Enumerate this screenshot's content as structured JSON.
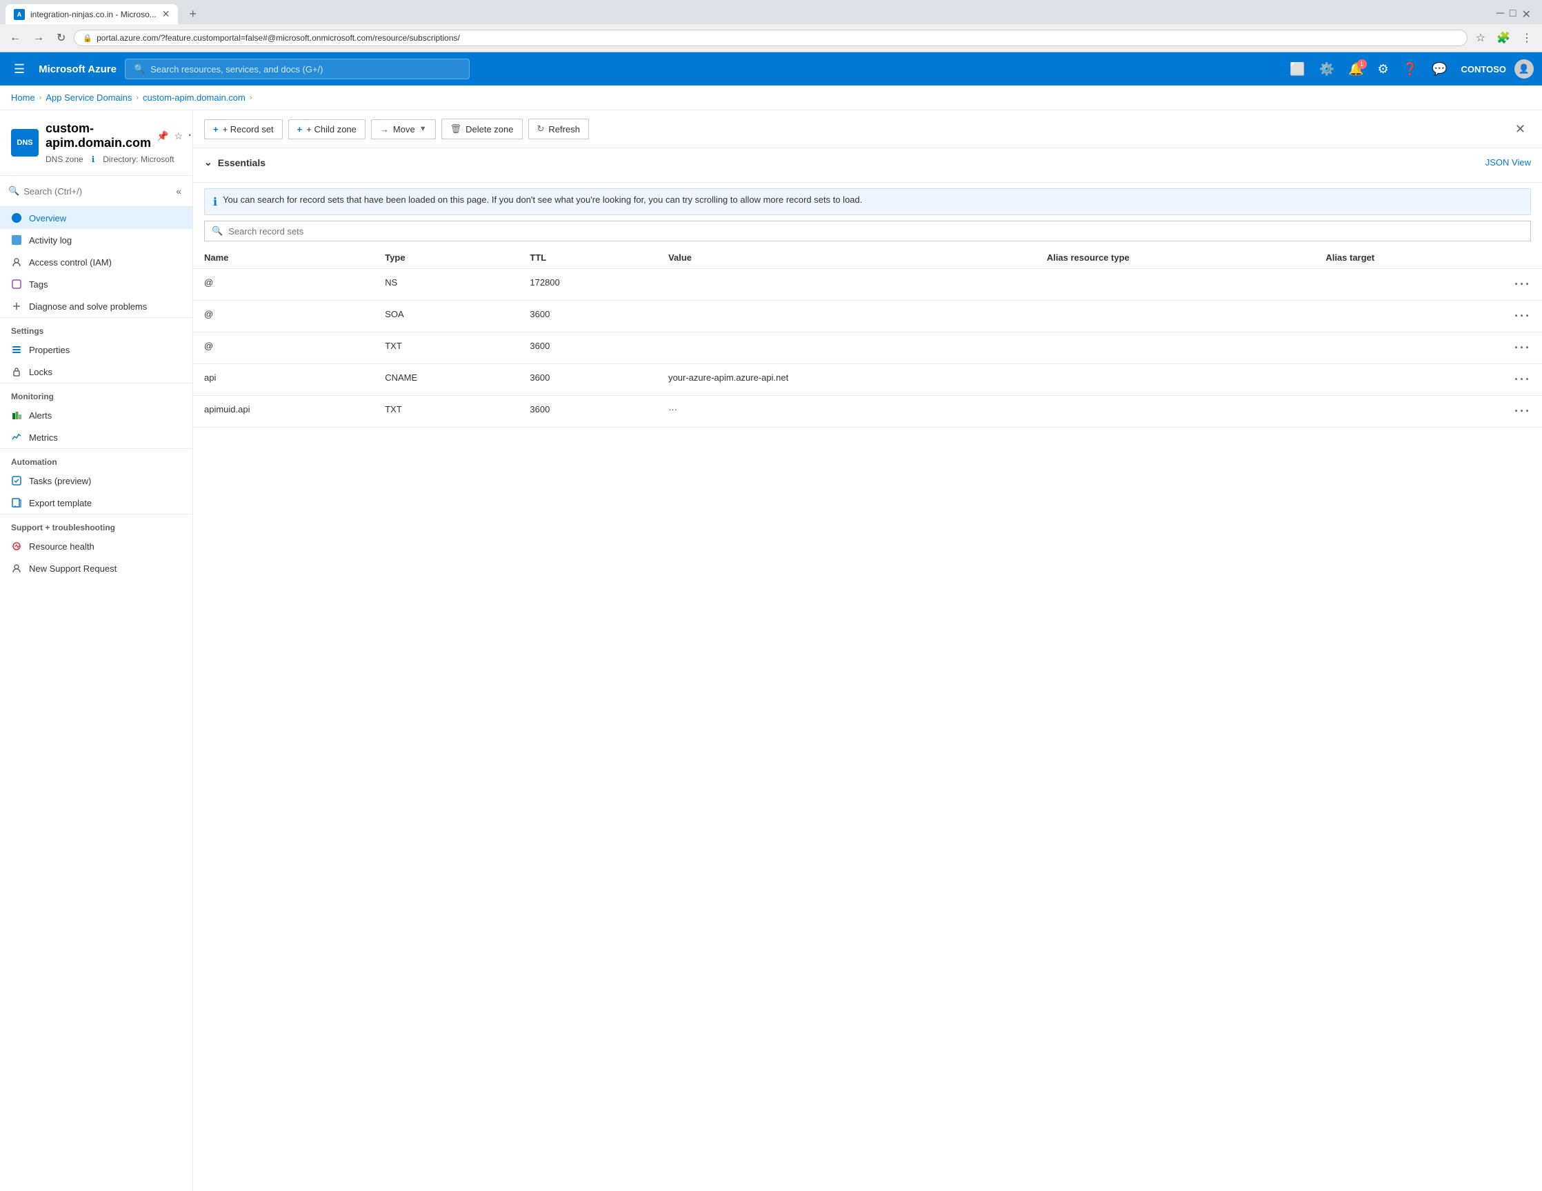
{
  "browser": {
    "tab_title": "integration-ninjas.co.in - Microso...",
    "tab_new": "+",
    "url": "portal.azure.com/?feature.customportal=false#@microsoft.onmicrosoft.com/resource/subscriptions/",
    "nav_back": "←",
    "nav_forward": "→",
    "nav_refresh": "↻"
  },
  "topnav": {
    "hamburger": "☰",
    "logo": "Microsoft Azure",
    "search_placeholder": "Search resources, services, and docs (G+/)",
    "notification_count": "1",
    "user_name": "CONTOSO"
  },
  "breadcrumb": {
    "home": "Home",
    "app_service_domains": "App Service Domains",
    "current": "custom-apim.domain.com",
    "sep": "›"
  },
  "resource": {
    "icon_text": "DNS",
    "name": "custom-apim.domain.com",
    "subtitle_type": "DNS zone",
    "subtitle_directory": "Directory: Microsoft",
    "pin_icon": "📌",
    "star_icon": "☆",
    "more_icon": "···"
  },
  "sidebar": {
    "search_placeholder": "Search (Ctrl+/)",
    "items": [
      {
        "id": "overview",
        "label": "Overview",
        "active": true
      },
      {
        "id": "activity-log",
        "label": "Activity log",
        "active": false
      },
      {
        "id": "access-control",
        "label": "Access control (IAM)",
        "active": false
      },
      {
        "id": "tags",
        "label": "Tags",
        "active": false
      },
      {
        "id": "diagnose",
        "label": "Diagnose and solve problems",
        "active": false
      }
    ],
    "sections": [
      {
        "title": "Settings",
        "items": [
          {
            "id": "properties",
            "label": "Properties"
          },
          {
            "id": "locks",
            "label": "Locks"
          }
        ]
      },
      {
        "title": "Monitoring",
        "items": [
          {
            "id": "alerts",
            "label": "Alerts"
          },
          {
            "id": "metrics",
            "label": "Metrics"
          }
        ]
      },
      {
        "title": "Automation",
        "items": [
          {
            "id": "tasks",
            "label": "Tasks (preview)"
          },
          {
            "id": "export-template",
            "label": "Export template"
          }
        ]
      },
      {
        "title": "Support + troubleshooting",
        "items": [
          {
            "id": "resource-health",
            "label": "Resource health"
          },
          {
            "id": "new-support",
            "label": "New Support Request"
          }
        ]
      }
    ]
  },
  "toolbar": {
    "record_set_label": "+ Record set",
    "child_zone_label": "+ Child zone",
    "move_label": "→ Move",
    "delete_zone_label": "Delete zone",
    "refresh_label": "Refresh"
  },
  "essentials": {
    "title": "Essentials",
    "json_view": "JSON View",
    "collapse_icon": "⌄"
  },
  "info_banner": {
    "text": "You can search for record sets that have been loaded on this page. If you don't see what you're looking for, you can try scrolling to allow more record sets to load."
  },
  "search_records": {
    "placeholder": "Search record sets"
  },
  "table": {
    "columns": [
      "Name",
      "Type",
      "TTL",
      "Value",
      "Alias resource type",
      "Alias target"
    ],
    "rows": [
      {
        "name": "@",
        "type": "NS",
        "ttl": "172800",
        "value": "",
        "alias_resource_type": "",
        "alias_target": ""
      },
      {
        "name": "@",
        "type": "SOA",
        "ttl": "3600",
        "value": "",
        "alias_resource_type": "",
        "alias_target": ""
      },
      {
        "name": "@",
        "type": "TXT",
        "ttl": "3600",
        "value": "",
        "alias_resource_type": "",
        "alias_target": ""
      },
      {
        "name": "api",
        "type": "CNAME",
        "ttl": "3600",
        "value": "your-azure-apim.azure-api.net",
        "alias_resource_type": "",
        "alias_target": ""
      },
      {
        "name": "apimuid.api",
        "type": "TXT",
        "ttl": "3600",
        "value": "···",
        "alias_resource_type": "",
        "alias_target": ""
      }
    ]
  }
}
